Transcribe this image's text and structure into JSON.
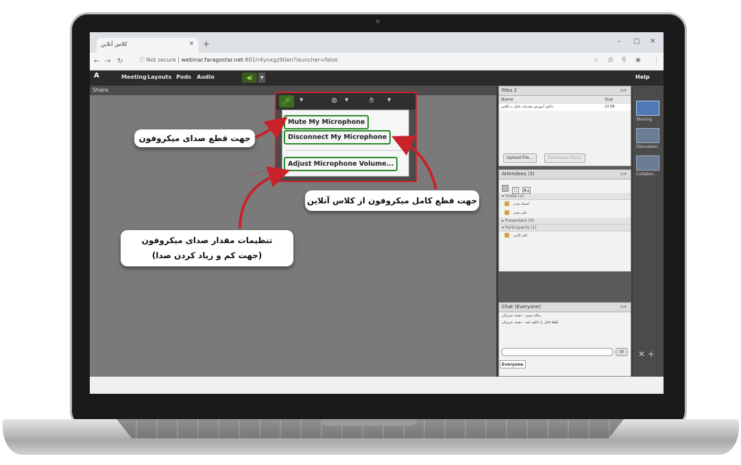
{
  "browser": {
    "tab_title": "کلاس آنلاین",
    "tab_close": "×",
    "new_tab": "+",
    "window_controls": [
      "–",
      "▢",
      "✕"
    ],
    "not_secure": "Not secure",
    "url_host": "webinar.faragostar.net",
    "url_rest": ":801/r4ynxgz90en?launcher=false",
    "right_icons": [
      "☆",
      "⎙",
      "⚲",
      "⋮"
    ]
  },
  "app": {
    "logo": "A",
    "menus": [
      "Meeting",
      "Layouts",
      "Pods",
      "Audio"
    ],
    "help": "Help",
    "share_title": "Share"
  },
  "mic_menu": {
    "items": [
      "Mute My Microphone",
      "Disconnect My Microphone",
      "Adjust Microphone Volume..."
    ]
  },
  "files_pod": {
    "title": "Files 2",
    "col_name": "Name",
    "col_size": "Size",
    "row_name": "دانلود آموزش مقدمات فایل به کلاس",
    "row_size": "23 KB",
    "upload": "Upload File...",
    "download": "Download File(s)"
  },
  "attendees_pod": {
    "title": "Attendees (3)",
    "hosts": "Hosts (2)",
    "host_names": [
      "اعتماد مدیر",
      "علی مدیر"
    ],
    "presenters": "Presenters (0)",
    "participants": "Participants (1)",
    "participant_names": [
      "علی کاربر"
    ]
  },
  "chat_pod": {
    "title": "Chat (Everyone)",
    "messages": [
      "سلام خوبی : نعیمه عزیزیان",
      "لطفا فایل را دانلود کنید : نعیمه عزیزیان"
    ],
    "tab": "Everyone"
  },
  "layouts_bar": {
    "items": [
      "Sharing",
      "Discussion",
      "Collabor..."
    ]
  },
  "callouts": {
    "mute": "جهت قطع صدای میکروفون",
    "disconnect": "جهت قطع کامل میکروفون از کلاس آنلاین",
    "volume_line1": "تنظیمات مقدار صدای میکروفون",
    "volume_line2": "(جهت کم و زیاد کردن صدا)"
  },
  "colors": {
    "highlight_red": "#c8222a",
    "item_border_green": "#2a8a2a",
    "arrow_red": "#c8222a"
  }
}
